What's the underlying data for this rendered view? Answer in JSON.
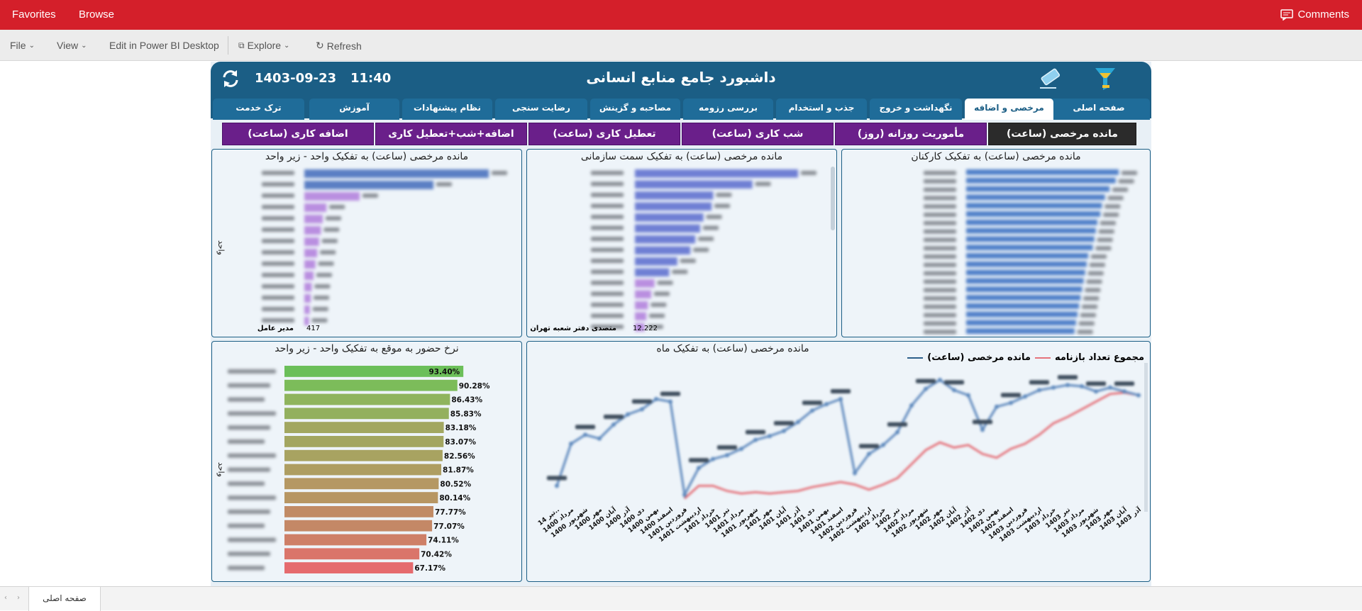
{
  "topbar": {
    "favorites": "Favorites",
    "browse": "Browse",
    "comments": "Comments"
  },
  "toolbar": {
    "file": "File",
    "view": "View",
    "edit": "Edit in Power BI Desktop",
    "explore": "Explore",
    "refresh": "Refresh"
  },
  "header": {
    "title": "داشبورد جامع منابع انسانی",
    "time": "11:40",
    "date": "1403-09-23"
  },
  "tabs": [
    {
      "label": "صفحه اصلی",
      "active": false
    },
    {
      "label": "مرخصی و اضافه کاری",
      "active": true
    },
    {
      "label": "نگهداشت و خروج",
      "active": false
    },
    {
      "label": "جذب و استخدام",
      "active": false
    },
    {
      "label": "بررسی رزومه",
      "active": false
    },
    {
      "label": "مصاحبه و گزینش",
      "active": false
    },
    {
      "label": "رضایت سنجی",
      "active": false
    },
    {
      "label": "نظام پیشنهادات",
      "active": false
    },
    {
      "label": "آموزش",
      "active": false
    },
    {
      "label": "ترک خدمت",
      "active": false
    }
  ],
  "subtabs": [
    {
      "label": "مانده مرخصی (ساعت)",
      "active": true
    },
    {
      "label": "مأموریت روزانه (روز)",
      "active": false
    },
    {
      "label": "شب کاری (ساعت)",
      "active": false
    },
    {
      "label": "تعطیل کاری (ساعت)",
      "active": false
    },
    {
      "label": "اضافه+شب+تعطیل کاری (ساعت)",
      "active": false
    },
    {
      "label": "اضافه کاری (ساعت)",
      "active": false
    }
  ],
  "panels": {
    "unit_leave_title": "مانده مرخصی (ساعت) به تفکیک واحد - زیر واحد",
    "org_leave_title": "مانده مرخصی (ساعت) به تفکیک سمت سازمانی",
    "staff_leave_title": "مانده مرخصی (ساعت) به تفکیک کارکنان",
    "attendance_title": "نرخ حضور به موقع به تفکیک واحد - زیر واحد",
    "monthly_title": "مانده مرخصی (ساعت) به تفکیک ماه",
    "axis_unit": "واحد",
    "unit_last_label": "مدیر عامل",
    "unit_last_value": "417",
    "org_last_label": "متصدی دفتر شعبه تهران",
    "org_last_value": "12.222"
  },
  "chart_data": [
    {
      "type": "bar",
      "title": "نرخ حضور به موقع به تفکیک واحد - زیر واحد",
      "ylabel": "واحد",
      "values": [
        93.4,
        90.28,
        86.43,
        85.83,
        83.18,
        83.07,
        82.56,
        81.87,
        80.52,
        80.14,
        77.77,
        77.07,
        74.11,
        70.42,
        67.17
      ],
      "data_labels": [
        "93.40%",
        "90.28%",
        "86.43%",
        "85.83%",
        "83.18%",
        "83.07%",
        "82.56%",
        "81.87%",
        "80.52%",
        "80.14%",
        "77.77%",
        "77.07%",
        "74.11%",
        "70.42%",
        "67.17%"
      ],
      "colors": [
        "#6bbf59",
        "#7cbc5a",
        "#8fb45d",
        "#93b05e",
        "#a2a760",
        "#a3a660",
        "#a8a361",
        "#ae9e62",
        "#b59863",
        "#b79663",
        "#c18b65",
        "#c48866",
        "#ce7f67",
        "#da756a",
        "#e56b6e"
      ]
    },
    {
      "type": "line",
      "title": "مانده مرخصی (ساعت) به تفکیک ماه",
      "legend": [
        "مجموع تعداد بازنامه",
        "مانده مرخصی (ساعت)"
      ],
      "legend_colors": [
        "#e5737b",
        "#2c5f8a"
      ],
      "x_labels": [
        "تیر 14..",
        "مرداد 1400",
        "شهریور 1400",
        "مهر 1400",
        "آبان 1400",
        "آذر 1400",
        "دی 1400",
        "بهمن 1400",
        "اسفند 1400",
        "فروردین 1401",
        "اردیبهشت 1401",
        "خرداد 1401",
        "تیر 1401",
        "مرداد 1401",
        "شهریور 1401",
        "مهر 1401",
        "آبان 1401",
        "آذر 1401",
        "دی 1401",
        "بهمن 1401",
        "اسفند 1401",
        "فروردین 1402",
        "اردیبهشت 1402",
        "خرداد 1402",
        "تیر 1402",
        "مرداد 1402",
        "شهریور 1402",
        "مهر 1402",
        "آبان 1402",
        "آذر 1402",
        "دی 1402",
        "بهمن 1402",
        "اسفند 1402",
        "فروردین 1403",
        "اردیبهشت 1403",
        "خرداد 1403",
        "تیر 1403",
        "مرداد 1403",
        "شهریور 1403",
        "مهر 1403",
        "آبان 1403",
        "آذر 1403"
      ]
    }
  ]
}
